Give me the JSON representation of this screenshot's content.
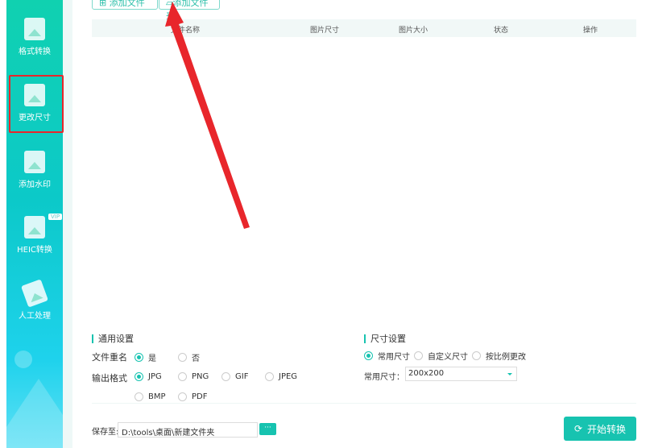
{
  "sidebar": {
    "items": [
      {
        "label": "格式转换"
      },
      {
        "label": "更改尺寸"
      },
      {
        "label": "添加水印"
      },
      {
        "label": "HEIC转换",
        "badge": "VIP"
      },
      {
        "label": "人工处理"
      }
    ]
  },
  "toolbar": {
    "add_file": "添加文件",
    "add_folder": "添加文件夹"
  },
  "table": {
    "columns": [
      "文件名称",
      "图片尺寸",
      "图片大小",
      "状态",
      "操作"
    ]
  },
  "general": {
    "title": "通用设置",
    "rename_label": "文件重名",
    "rename_options": [
      "是",
      "否"
    ],
    "format_label": "输出格式",
    "formats": [
      "JPG",
      "PNG",
      "GIF",
      "JPEG",
      "BMP",
      "PDF"
    ]
  },
  "size": {
    "title": "尺寸设置",
    "modes": [
      "常用尺寸",
      "自定义尺寸",
      "按比例更改"
    ],
    "common_label": "常用尺寸：",
    "common_value": "200x200"
  },
  "save": {
    "label": "保存至:",
    "path": "D:\\tools\\桌面\\新建文件夹",
    "browse": "···"
  },
  "start_label": "开始转换",
  "colors": {
    "accent": "#17c3b0",
    "annotation": "#e8262b"
  }
}
